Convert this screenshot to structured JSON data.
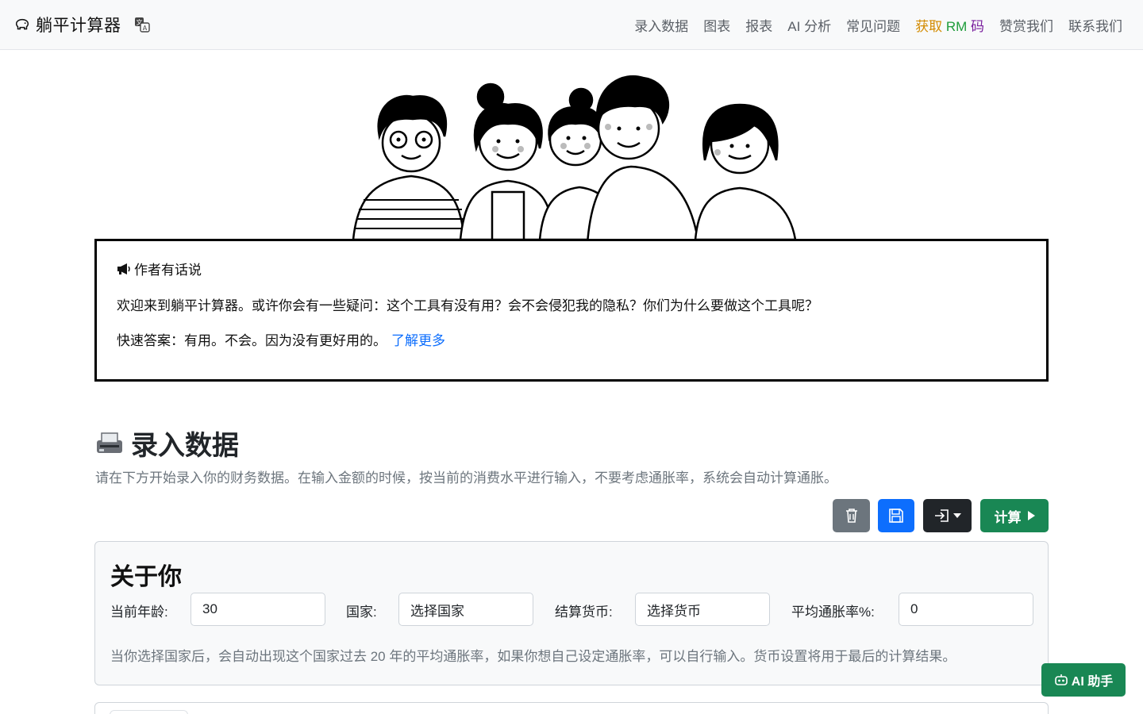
{
  "app": {
    "title": "躺平计算器"
  },
  "nav": {
    "items": [
      "录入数据",
      "图表",
      "报表",
      "AI 分析",
      "常见问题"
    ],
    "rm": [
      "获取",
      "RM",
      "码"
    ],
    "items_after": [
      "赞赏我们",
      "联系我们"
    ]
  },
  "author_box": {
    "title": "作者有话说",
    "p1": "欢迎来到躺平计算器。或许你会有一些疑问：这个工具有没有用？会不会侵犯我的隐私？你们为什么要做这个工具呢？",
    "p2": "快速答案：有用。不会。因为没有更好用的。",
    "learn_more": "了解更多"
  },
  "section": {
    "title": "录入数据",
    "description": "请在下方开始录入你的财务数据。在输入金额的时候，按当前的消费水平进行输入，不要考虑通胀率，系统会自动计算通胀。"
  },
  "toolbar": {
    "calculate": "计算"
  },
  "about": {
    "title": "关于你",
    "age_label": "当前年龄:",
    "age_value": "30",
    "country_label": "国家:",
    "country_value": "选择国家",
    "currency_label": "结算货币:",
    "currency_value": "选择货币",
    "inflation_label": "平均通胀率%:",
    "inflation_value": "0",
    "help": "当你选择国家后，会自动出现这个国家过去 20 年的平均通胀率，如果你想自己设定通胀率，可以自行输入。货币设置将用于最后的计算结果。"
  },
  "ai_helper": {
    "label": "AI 助手"
  },
  "colors": {
    "primary": "#0d6efd",
    "success": "#198754",
    "secondary": "#6c757d",
    "dark": "#212529"
  }
}
